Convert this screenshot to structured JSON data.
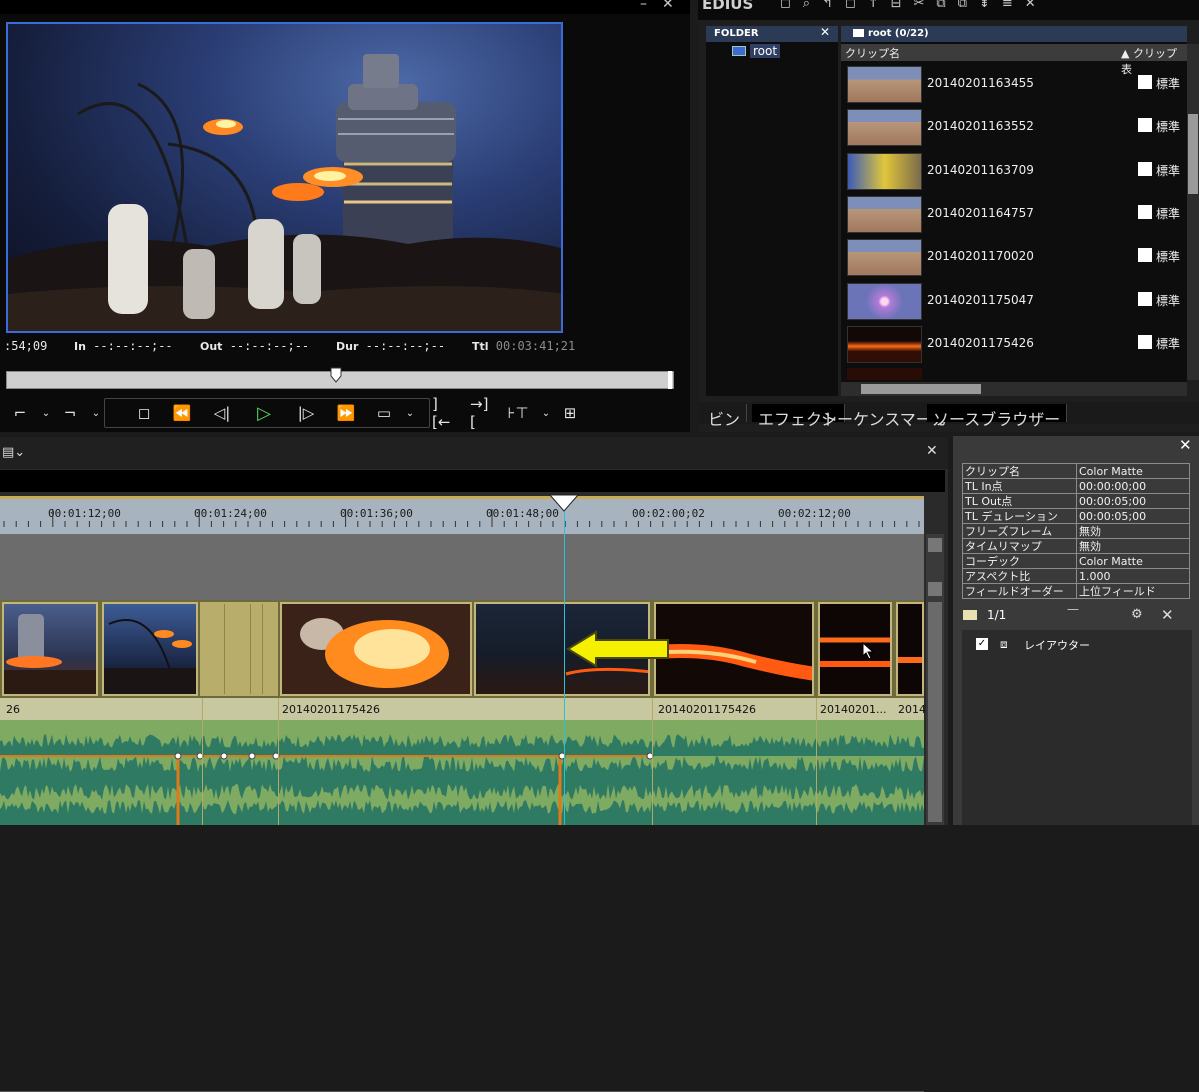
{
  "app": {
    "name": "EDIUS"
  },
  "preview": {
    "timecode": ":54;09",
    "in_label": "In",
    "in_value": "--:--:--;--",
    "out_label": "Out",
    "out_value": "--:--:--;--",
    "dur_label": "Dur",
    "dur_value": "--:--:--;--",
    "ttl_label": "Ttl",
    "ttl_value": "00:03:41;21",
    "transport": [
      "stop-icon",
      "rewind-icon",
      "step-back-icon",
      "play-icon",
      "step-forward-icon",
      "fast-forward-icon",
      "loop-icon"
    ]
  },
  "bin": {
    "folder_header": "FOLDER",
    "folder_root": "root",
    "clip_header": "root (0/22)",
    "col_clipname": "クリップ名",
    "col_sort": "▲ クリップ表",
    "clips": [
      {
        "name": "20140201163455",
        "type": "標準",
        "thumb": "field"
      },
      {
        "name": "20140201163552",
        "type": "標準",
        "thumb": "field"
      },
      {
        "name": "20140201163709",
        "type": "標準",
        "thumb": "crowd"
      },
      {
        "name": "20140201164757",
        "type": "標準",
        "thumb": "field"
      },
      {
        "name": "20140201170020",
        "type": "標準",
        "thumb": "field"
      },
      {
        "name": "20140201175047",
        "type": "標準",
        "thumb": "fireworks"
      },
      {
        "name": "20140201175426",
        "type": "標準",
        "thumb": "fire"
      }
    ],
    "tabs": [
      "ビン",
      "エフェクト",
      "シーケンスマーカー",
      "ソースブラウザー"
    ]
  },
  "timeline": {
    "ruler": [
      "00:01:12;00",
      "00:01:24;00",
      "00:01:36;00",
      "00:01:48;00",
      "00:02:00;02",
      "00:02:12;00"
    ],
    "clip_names": [
      "26",
      "20140201175426",
      "20140201175426",
      "20140201...",
      "2014"
    ]
  },
  "info": {
    "rows": [
      {
        "k": "クリップ名",
        "v": "Color Matte"
      },
      {
        "k": "TL In点",
        "v": "00:00:00;00"
      },
      {
        "k": "TL Out点",
        "v": "00:00:05;00"
      },
      {
        "k": "TL デュレーション",
        "v": "00:00:05;00"
      },
      {
        "k": "フリーズフレーム",
        "v": "無効"
      },
      {
        "k": "タイムリマップ",
        "v": "無効"
      },
      {
        "k": "コーデック",
        "v": "Color Matte"
      },
      {
        "k": "アスペクト比",
        "v": "1.000"
      },
      {
        "k": "フィールドオーダー",
        "v": "上位フィールド"
      }
    ],
    "layer_count": "1/1",
    "layer_name": "レイアウター"
  },
  "colors": {
    "selection": "#3a6bd8",
    "playhead": "#29c3d8",
    "ruler_accent": "#c9aa55",
    "arrow": "#f5f000"
  }
}
